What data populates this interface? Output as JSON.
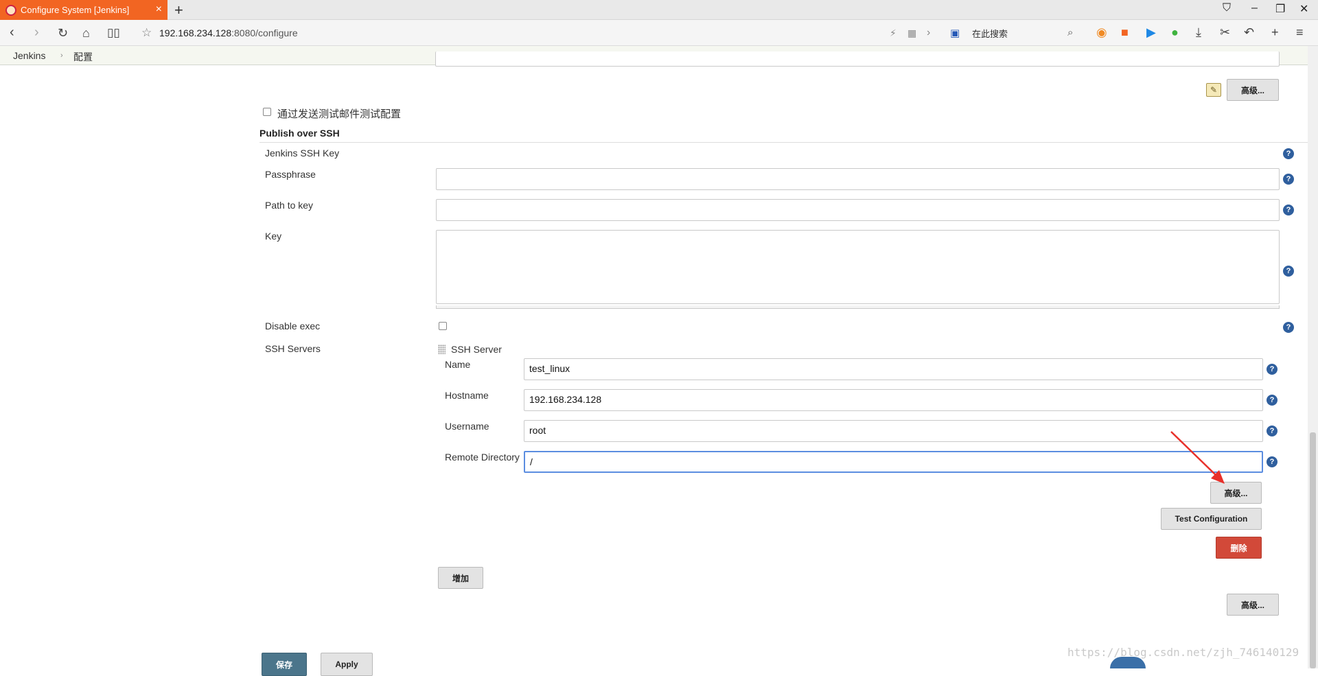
{
  "browser": {
    "tab_title": "Configure System [Jenkins]",
    "url_host": "192.168.234.128",
    "url_path": ":8080/configure",
    "search_placeholder": "在此搜索"
  },
  "breadcrumb": {
    "root": "Jenkins",
    "current": "配置"
  },
  "top": {
    "advanced_label": "高级..."
  },
  "test_mail": {
    "label": "通过发送测试邮件测试配置"
  },
  "ssh": {
    "section_title": "Publish over SSH",
    "jenkins_ssh_key": "Jenkins SSH Key",
    "passphrase_label": "Passphrase",
    "passphrase_value": "",
    "path_to_key_label": "Path to key",
    "path_to_key_value": "",
    "key_label": "Key",
    "key_value": "",
    "disable_exec_label": "Disable exec",
    "ssh_servers_label": "SSH Servers",
    "server": {
      "title": "SSH Server",
      "name_label": "Name",
      "name_value": "test_linux",
      "hostname_label": "Hostname",
      "hostname_value": "192.168.234.128",
      "username_label": "Username",
      "username_value": "root",
      "remote_dir_label": "Remote Directory",
      "remote_dir_value": "/",
      "advanced_label": "高级...",
      "test_config_label": "Test Configuration",
      "delete_label": "删除"
    },
    "add_label": "增加",
    "advanced_label": "高级..."
  },
  "footer": {
    "save_label": "保存",
    "apply_label": "Apply"
  },
  "watermark": "https://blog.csdn.net/zjh_746140129",
  "colors": {
    "tab_accent": "#f26522",
    "help_icon": "#2f5f9e",
    "delete_button": "#d24939",
    "save_button": "#4b758b",
    "arrow": "#e8302a"
  }
}
